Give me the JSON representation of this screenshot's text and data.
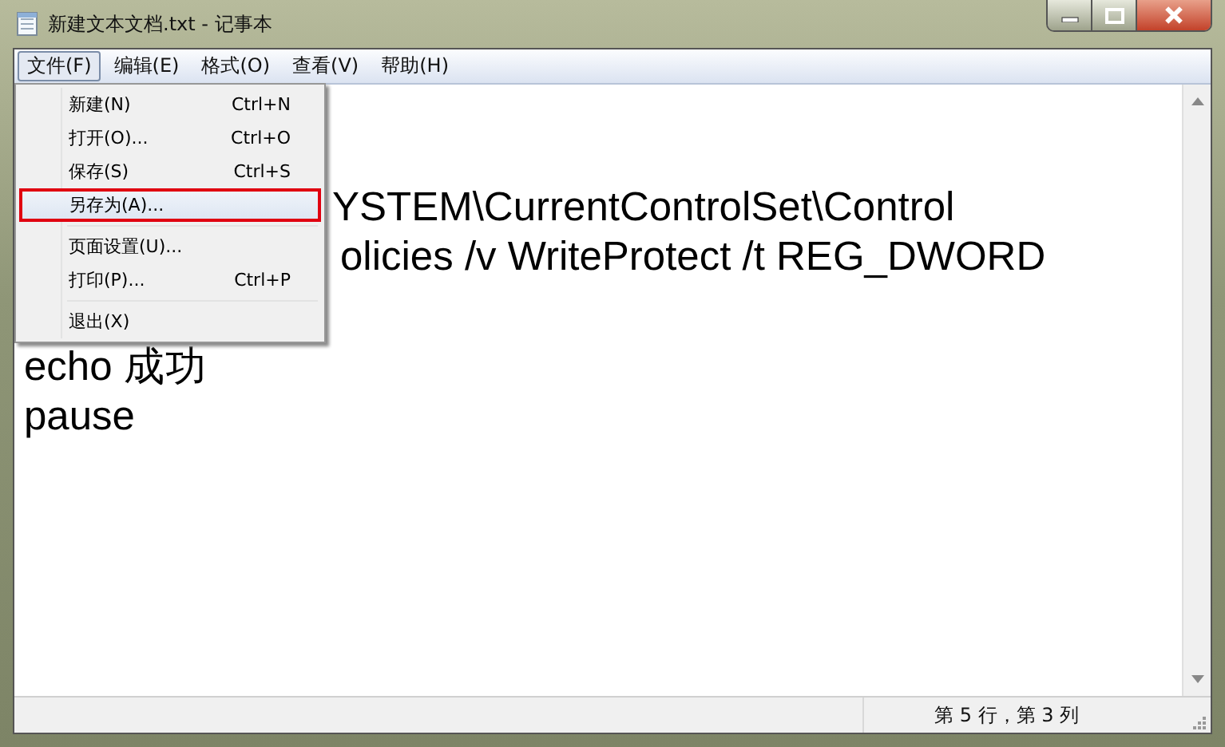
{
  "window": {
    "title": "新建文本文档.txt - 记事本"
  },
  "menu_bar": [
    {
      "label": "文件(F)",
      "selected": true
    },
    {
      "label": "编辑(E)",
      "selected": false
    },
    {
      "label": "格式(O)",
      "selected": false
    },
    {
      "label": "查看(V)",
      "selected": false
    },
    {
      "label": "帮助(H)",
      "selected": false
    }
  ],
  "file_menu": [
    {
      "kind": "item",
      "label": "新建(N)",
      "shortcut": "Ctrl+N",
      "selected": false
    },
    {
      "kind": "item",
      "label": "打开(O)...",
      "shortcut": "Ctrl+O",
      "selected": false
    },
    {
      "kind": "item",
      "label": "保存(S)",
      "shortcut": "Ctrl+S",
      "selected": false
    },
    {
      "kind": "item",
      "label": "另存为(A)...",
      "selected": true
    },
    {
      "kind": "separator"
    },
    {
      "kind": "item",
      "label": "页面设置(U)...",
      "selected": false
    },
    {
      "kind": "item",
      "label": "打印(P)...",
      "shortcut": "Ctrl+P",
      "selected": false
    },
    {
      "kind": "separator"
    },
    {
      "kind": "item",
      "label": "退出(X)",
      "selected": false
    }
  ],
  "editor": {
    "lines": [
      "YSTEM\\CurrentControlSet\\Control",
      "olicies /v WriteProtect /t REG_DWORD",
      "echo 成功",
      "pause"
    ]
  },
  "status_bar": {
    "position": "第 5 行，第 3 列"
  }
}
